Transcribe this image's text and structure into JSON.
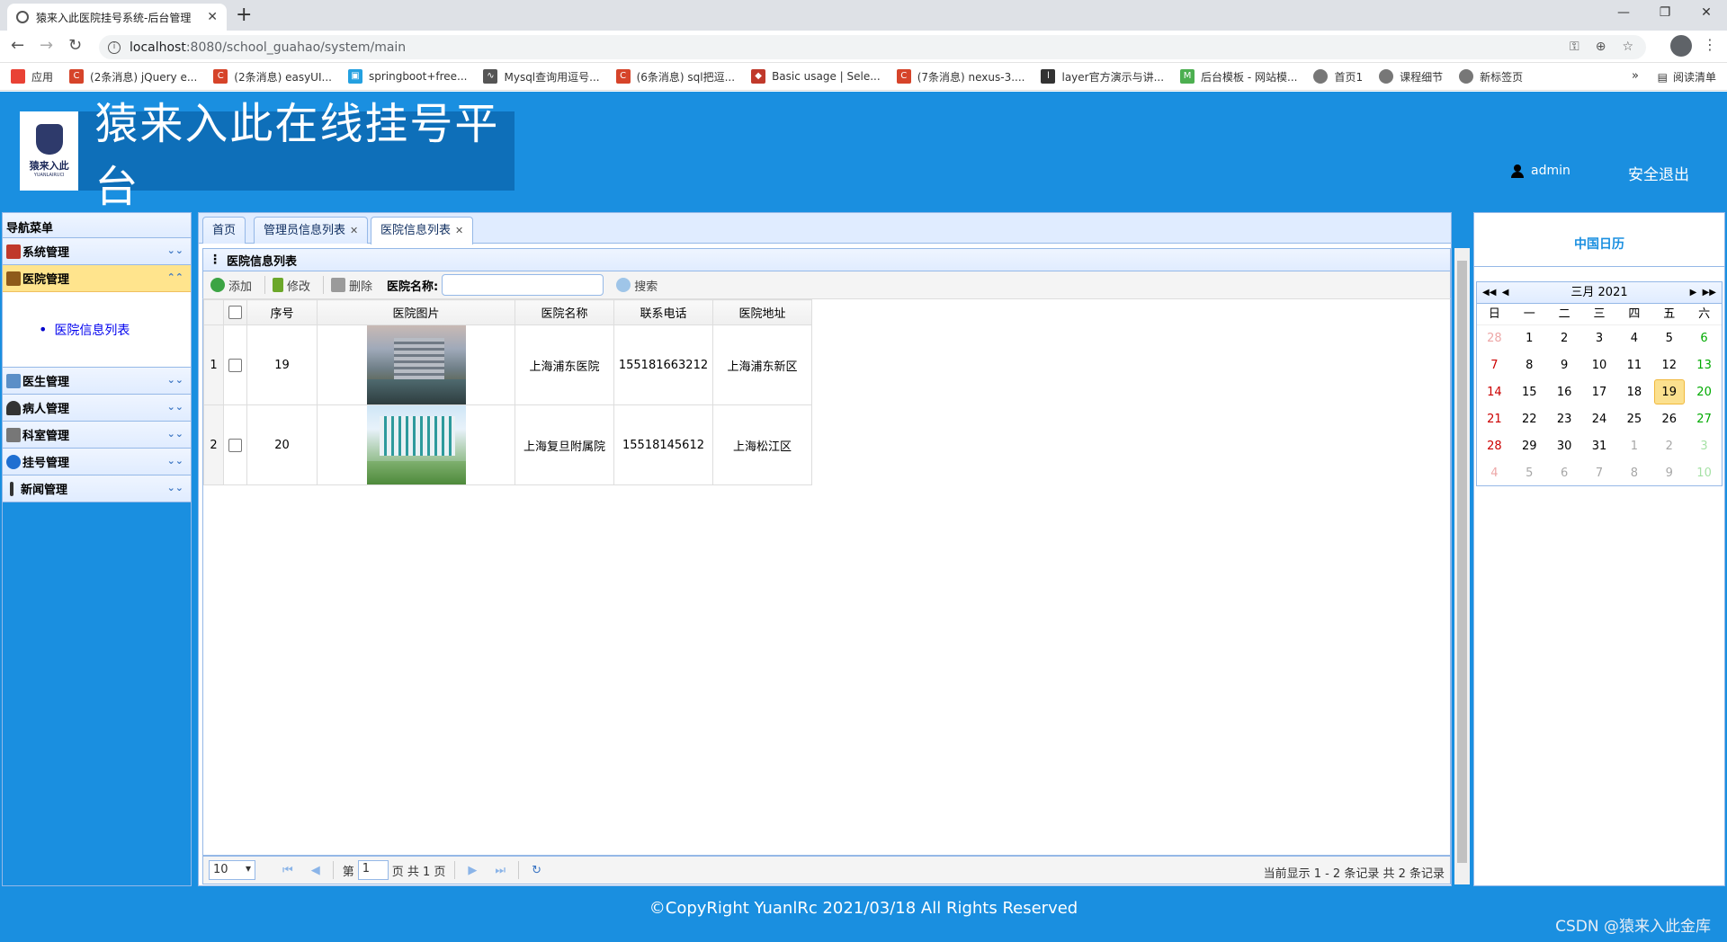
{
  "browser": {
    "tab_title": "猿来入此医院挂号系统-后台管理",
    "url_host": "localhost",
    "url_path": ":8080/school_guahao/system/main",
    "bookmarks": [
      {
        "label": "应用",
        "color": "#e94235"
      },
      {
        "label": "(2条消息) jQuery e...",
        "color": "#d6442a"
      },
      {
        "label": "(2条消息) easyUI...",
        "color": "#d6442a"
      },
      {
        "label": "springboot+free...",
        "color": "#23a0e0"
      },
      {
        "label": "Mysql查询用逗号...",
        "color": "#555555"
      },
      {
        "label": "(6条消息) sql把逗...",
        "color": "#d6442a"
      },
      {
        "label": "Basic usage | Sele...",
        "color": "#c0392b"
      },
      {
        "label": "(7条消息) nexus-3....",
        "color": "#d6442a"
      },
      {
        "label": "layer官方演示与讲...",
        "color": "#333333"
      },
      {
        "label": "后台模板 - 网站模...",
        "color": "#4caf50"
      },
      {
        "label": "首页1",
        "color": "#777777"
      },
      {
        "label": "课程细节",
        "color": "#777777"
      },
      {
        "label": "新标签页",
        "color": "#777777"
      }
    ],
    "bookmarks_more": "»",
    "reading_list": "阅读清单"
  },
  "header": {
    "site_title": "猿来入此在线挂号平台",
    "logo_cn": "猿来入此",
    "logo_en": "YUANLAIRUCI",
    "username": "admin",
    "logout": "安全退出"
  },
  "sidebar": {
    "title": "导航菜单",
    "items": [
      {
        "label": "系统管理",
        "icon_color": "#c0392b"
      },
      {
        "label": "医院管理",
        "icon_color": "#8e5a1a"
      },
      {
        "label": "医生管理",
        "icon_color": "#5b8fc7"
      },
      {
        "label": "病人管理",
        "icon_color": "#333333"
      },
      {
        "label": "科室管理",
        "icon_color": "#777777"
      },
      {
        "label": "挂号管理",
        "icon_color": "#1f6fd1"
      },
      {
        "label": "新闻管理",
        "icon_color": "#333333"
      }
    ],
    "open_link": "医院信息列表"
  },
  "tabs": [
    "首页",
    "管理员信息列表",
    "医院信息列表"
  ],
  "panel": {
    "title": "医院信息列表",
    "toolbar": {
      "add": "添加",
      "edit": "修改",
      "delete": "删除",
      "name_label": "医院名称:",
      "name_value": "",
      "search": "搜索"
    }
  },
  "table": {
    "columns": [
      "序号",
      "医院图片",
      "医院名称",
      "联系电话",
      "医院地址"
    ],
    "rows": [
      {
        "rownum": "1",
        "id": "19",
        "name": "上海浦东医院",
        "phone": "155181663212",
        "address": "上海浦东新区"
      },
      {
        "rownum": "2",
        "id": "20",
        "name": "上海复旦附属院",
        "phone": "15518145612",
        "address": "上海松江区"
      }
    ]
  },
  "pager": {
    "page_size": "10",
    "page_prefix": "第",
    "page_value": "1",
    "page_suffix": "页 共 1 页",
    "info": "当前显示 1 - 2 条记录 共 2 条记录"
  },
  "calendar": {
    "title": "中国日历",
    "month": "三月 2021",
    "weekdays": [
      "日",
      "一",
      "二",
      "三",
      "四",
      "五",
      "六"
    ],
    "weeks": [
      [
        "28",
        "1",
        "2",
        "3",
        "4",
        "5",
        "6"
      ],
      [
        "7",
        "8",
        "9",
        "10",
        "11",
        "12",
        "13"
      ],
      [
        "14",
        "15",
        "16",
        "17",
        "18",
        "19",
        "20"
      ],
      [
        "21",
        "22",
        "23",
        "24",
        "25",
        "26",
        "27"
      ],
      [
        "28",
        "29",
        "30",
        "31",
        "1",
        "2",
        "3"
      ],
      [
        "4",
        "5",
        "6",
        "7",
        "8",
        "9",
        "10"
      ]
    ],
    "today": "19"
  },
  "footer": {
    "copyright": "©CopyRight YuanlRc 2021/03/18 All Rights Reserved",
    "watermark": "CSDN @猿来入此金库"
  }
}
